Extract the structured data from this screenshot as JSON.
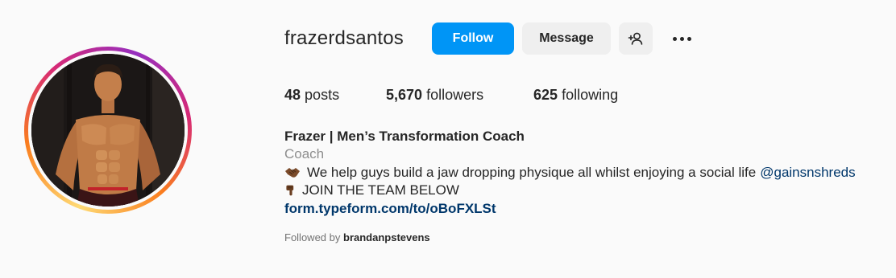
{
  "profile": {
    "username": "frazerdsantos",
    "avatar_alt": "avatar",
    "actions": {
      "follow_label": "Follow",
      "message_label": "Message",
      "suggest_icon": "person-plus-icon",
      "more_icon": "more-options-icon"
    },
    "stats": {
      "posts_count": "48",
      "posts_label": "posts",
      "followers_count": "5,670",
      "followers_label": "followers",
      "following_count": "625",
      "following_label": "following"
    },
    "full_name": "Frazer | Men’s Transformation Coach",
    "category": "Coach",
    "bio": {
      "line1": "We help guys build a jaw dropping physique all whilst enjoying a social life",
      "line1_icon": "handshake-emoji",
      "mention": "@gainsnshreds",
      "line2": "JOIN THE TEAM BELOW",
      "line2_icon": "pointing-down-emoji"
    },
    "link": "form.typeform.com/to/oBoFXLSt",
    "followed_by_prefix": "Followed by",
    "followed_by_user": "brandanpstevens"
  },
  "colors": {
    "primary": "#0095f6",
    "link": "#00376b",
    "secondary_text": "#8e8e8e",
    "background": "#fafafa"
  }
}
